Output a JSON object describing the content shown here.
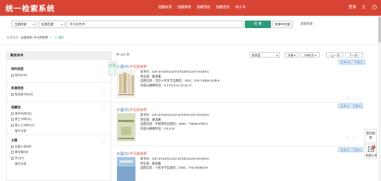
{
  "header": {
    "brand": "统一检索系统",
    "nav": [
      "馆藏目录",
      "馆藏推荐",
      "馆藏导航",
      "馆藏通览",
      "电子书"
    ],
    "login": "登录",
    "lang_icon": "translate-icon",
    "help_icon": "help-icon",
    "colors": {
      "header_bg": "#d84434",
      "accent": "#2e9b7b",
      "title_red": "#d84434",
      "link_blue": "#3a78b5"
    }
  },
  "search": {
    "scope": "全部检索",
    "match": "任意匹配",
    "query": "平凡的世界",
    "search_button": "检 索",
    "within_button": "结果中检索",
    "advanced_link": "高级检索",
    "condition_label": "检索条件",
    "condition_tag": "全部检索=平凡的世界",
    "clear_label": "清空"
  },
  "sidebar": {
    "title": "聚类条件",
    "apply_button": "应用",
    "facets": [
      {
        "title": "资料类型",
        "items": [
          "图书(123)"
        ],
        "more": ""
      },
      {
        "title": "资源类型",
        "items": [
          "纸质图书(123)"
        ],
        "more": ""
      },
      {
        "title": "馆藏地",
        "items": [
          "第四书库(30)",
          "第三书库(21)",
          "第十三书库(17)"
        ],
        "more": "展开全部"
      },
      {
        "title": "主题",
        "items": [
          "长篇小说(99)",
          "散文集(52)",
          "传记(7)"
        ],
        "more": "展开全部"
      }
    ]
  },
  "toolbar": {
    "total": "共 123 条",
    "sort": "相关度",
    "view": "详情",
    "per_page": "10条/页",
    "prev": "上一页",
    "next": "下一页",
    "prev_icon": "chevron-left-icon",
    "next_icon": "chevron-right-icon"
  },
  "results": [
    {
      "num": "1",
      "type": "[图书]",
      "title": "平凡的世界",
      "holding": "纸本(15) / 可借(3)",
      "meta": [
        "索书号：I247.57/L9/V2,I247.57/L9/V2,I247.57/L9/V1",
        "责任者：路遥著",
        "出版信息：北京十月文艺出版社；2021；978-7-5302-2135-6",
        "内容与摘要附注：3 4 5 6 9 11 13 15 17"
      ],
      "cover_bg": "#e9e6e0"
    },
    {
      "num": "2",
      "type": "[图书]",
      "title": "平凡的世界",
      "holding": "纸本(5) / 可借(5)",
      "meta": [
        "索书号：I247.57/L9/V2,I247.57/L9/V2,I247.57/L9/V1",
        "责任者：路遥著",
        "出版信息：中国青年出版社；2000；7-5006-3785-3",
        "内容与摘要附注：3 5 8 12"
      ],
      "cover_bg": "#c7d2a8"
    },
    {
      "num": "3",
      "type": "[图书]",
      "title": "平凡的世界",
      "holding": "纸本(5) / 可借(5)",
      "meta": [
        "索书号：I247.57/L9/V2,I247.57/L9/V2,I247.57/L9/V1",
        "责任者：路遥著",
        "出版信息：人民文学出版社；2004；7-02-004804-8"
      ],
      "cover_bg": "#9ec0df"
    }
  ],
  "side_tools": {
    "encyclopedia": "百科检索",
    "cart": "批量分享",
    "cart_count": "0"
  }
}
